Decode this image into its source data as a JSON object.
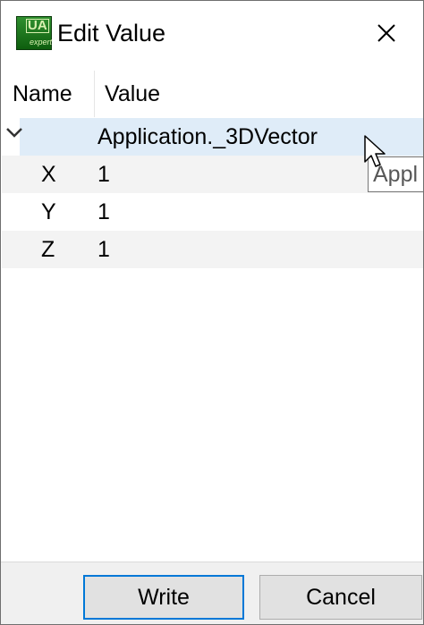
{
  "window": {
    "title": "Edit Value",
    "icon_text_top": "UA",
    "icon_text_bottom": "expert"
  },
  "table": {
    "columns": [
      "Name",
      "Value"
    ],
    "parent": {
      "name": "",
      "value": "Application._3DVector"
    },
    "rows": [
      {
        "name": "X",
        "value": "1"
      },
      {
        "name": "Y",
        "value": "1"
      },
      {
        "name": "Z",
        "value": "1"
      }
    ]
  },
  "tooltip": {
    "text": "Appl"
  },
  "buttons": {
    "write": "Write",
    "cancel": "Cancel"
  },
  "colors": {
    "selected_row": "#dfecf8",
    "alt_row": "#f3f3f3",
    "default_button_border": "#0078d7"
  }
}
